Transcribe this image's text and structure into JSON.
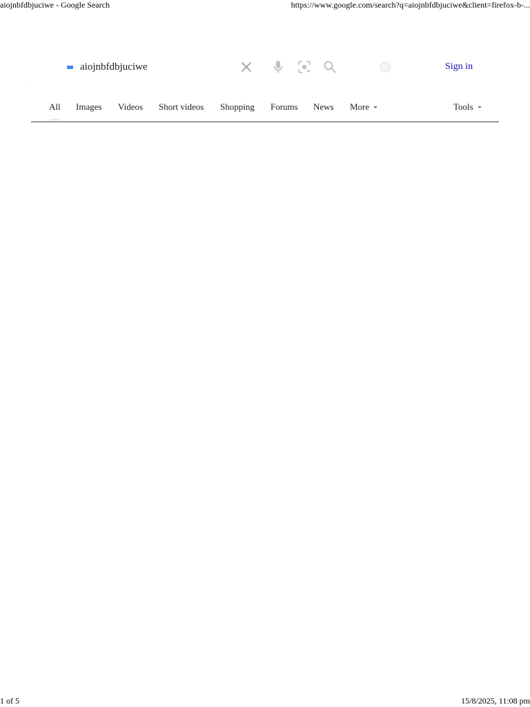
{
  "print_header": {
    "title": "aiojnbfdbjuciwe - Google Search",
    "url": "https://www.google.com/search?q=aiojnbfdbjuciwe&client=firefox-b-..."
  },
  "search": {
    "query": "aiojnbfdbjuciwe",
    "icons": {
      "clear": "close-icon",
      "voice": "mic-icon",
      "lens": "camera-lens-icon",
      "search": "search-icon",
      "settings": "gear-icon"
    }
  },
  "header": {
    "sign_in_label": "Sign in"
  },
  "tabs": {
    "items": [
      {
        "label": "All",
        "active": true
      },
      {
        "label": "Images"
      },
      {
        "label": "Videos"
      },
      {
        "label": "Short videos"
      },
      {
        "label": "Shopping"
      },
      {
        "label": "Forums"
      },
      {
        "label": "News"
      },
      {
        "label": "More"
      }
    ],
    "tools_label": "Tools"
  },
  "print_footer": {
    "page": "1 of 5",
    "datetime": "15/8/2025, 11:08 pm"
  },
  "colors": {
    "link": "#1a0dab",
    "accent": "#4285f4",
    "icon": "#9aa0a6",
    "settings_icon": "#dadce0"
  }
}
